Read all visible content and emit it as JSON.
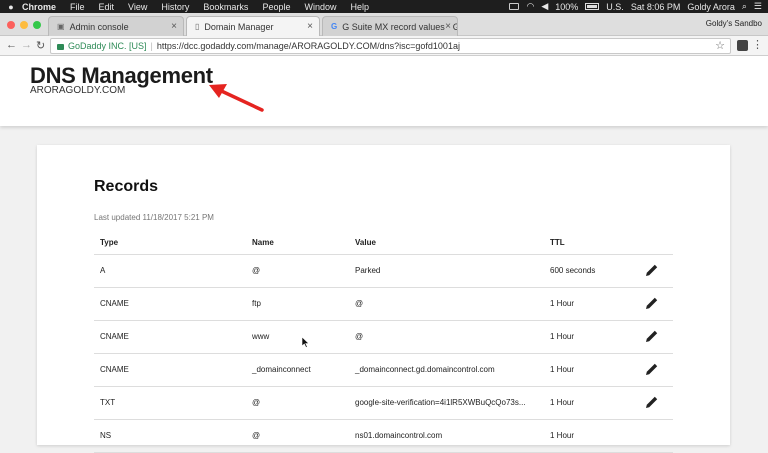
{
  "menubar": {
    "items": [
      "Chrome",
      "File",
      "Edit",
      "View",
      "History",
      "Bookmarks",
      "People",
      "Window",
      "Help"
    ],
    "battery": "100%",
    "input_source": "U.S.",
    "clock": "Sat 8:06 PM",
    "user": "Goldy Arora"
  },
  "tabs": [
    {
      "title": "Admin console"
    },
    {
      "title": "Domain Manager"
    },
    {
      "title": "G Suite MX record values - G"
    }
  ],
  "profile_name": "Goldy's Sandbo",
  "address": {
    "secure_label": "GoDaddy INC. [US]",
    "url": "https://dcc.godaddy.com/manage/ARORAGOLDY.COM/dns?isc=gofd1001aj"
  },
  "page": {
    "title": "DNS Management",
    "domain": "ARORAGOLDY.COM"
  },
  "records": {
    "title": "Records",
    "last_updated": "Last updated 11/18/2017 5:21 PM",
    "columns": [
      "Type",
      "Name",
      "Value",
      "TTL"
    ],
    "rows": [
      {
        "type": "A",
        "name": "@",
        "value": "Parked",
        "ttl": "600 seconds"
      },
      {
        "type": "CNAME",
        "name": "ftp",
        "value": "@",
        "ttl": "1 Hour"
      },
      {
        "type": "CNAME",
        "name": "www",
        "value": "@",
        "ttl": "1 Hour"
      },
      {
        "type": "CNAME",
        "name": "_domainconnect",
        "value": "_domainconnect.gd.domaincontrol.com",
        "ttl": "1 Hour"
      },
      {
        "type": "TXT",
        "name": "@",
        "value": "google-site-verification=4i1lR5XWBuQcQo73s...",
        "ttl": "1 Hour"
      },
      {
        "type": "NS",
        "name": "@",
        "value": "ns01.domaincontrol.com",
        "ttl": "1 Hour"
      }
    ]
  },
  "colors": {
    "annotation_arrow": "#e52420",
    "secure_green": "#2e8b57",
    "close_light": "#fc605c",
    "minimize_light": "#fdbc40",
    "zoom_light": "#34c84a"
  }
}
